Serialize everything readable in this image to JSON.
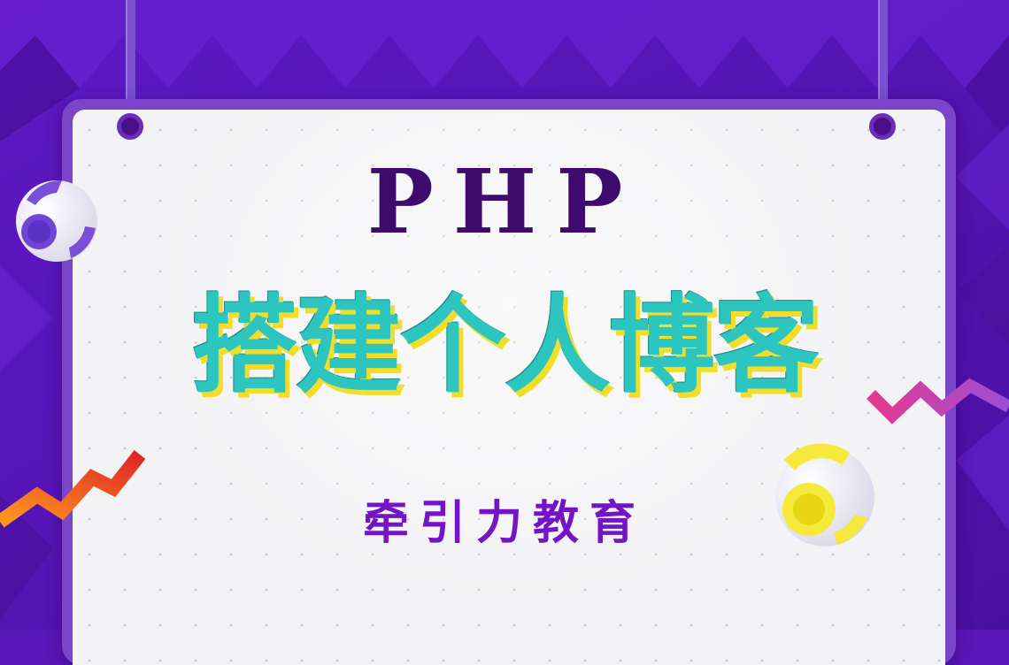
{
  "poster": {
    "title_php": "PHP",
    "title_main": "搭建个人博客",
    "subtitle": "牵引力教育"
  },
  "colors": {
    "background": "#5a16b8",
    "board_frame": "#7b45c9",
    "board_surface": "#f3f3f5",
    "title_php": "#3f0a6e",
    "title_main": "#2cc5c0",
    "title_main_shadow": "#f2de2a",
    "subtitle": "#7315c4"
  },
  "decorations": {
    "left_ball": "purple-striped-ball",
    "right_ball": "yellow-striped-ball",
    "left_zigzag": "orange-red-zigzag",
    "right_zigzag": "pink-purple-zigzag"
  }
}
